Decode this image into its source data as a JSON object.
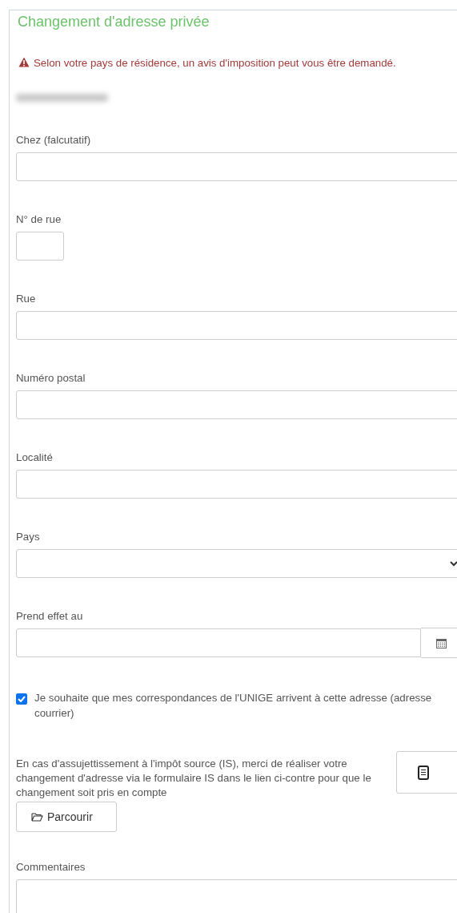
{
  "title": "Changement d'adresse privée",
  "warning": "Selon votre pays de résidence, un avis d'imposition peut vous être demandé.",
  "fields": [
    {
      "label": "Chez (falcutatif)",
      "kind": "text"
    },
    {
      "label": "N° de rue",
      "kind": "short"
    },
    {
      "label": "Rue",
      "kind": "text"
    },
    {
      "label": "Numéro postal",
      "kind": "text"
    },
    {
      "label": "Localité",
      "kind": "text"
    },
    {
      "label": "Pays",
      "kind": "select"
    },
    {
      "label": "Prend effet au",
      "kind": "date"
    }
  ],
  "consent": {
    "label": "Je souhaite que mes correspondances de l'UNIGE arrivent à cette adresse (adresse courrier)",
    "checked": true
  },
  "is_notice": {
    "text": "En cas d'assujettissement à l'impôt source (IS), merci de réaliser votre changement d'adresse via le formulaire IS dans le lien ci-contre pour que le changement soit pris en compte",
    "browse_button": "Parcourir"
  },
  "comments": {
    "label": "Commentaires"
  }
}
